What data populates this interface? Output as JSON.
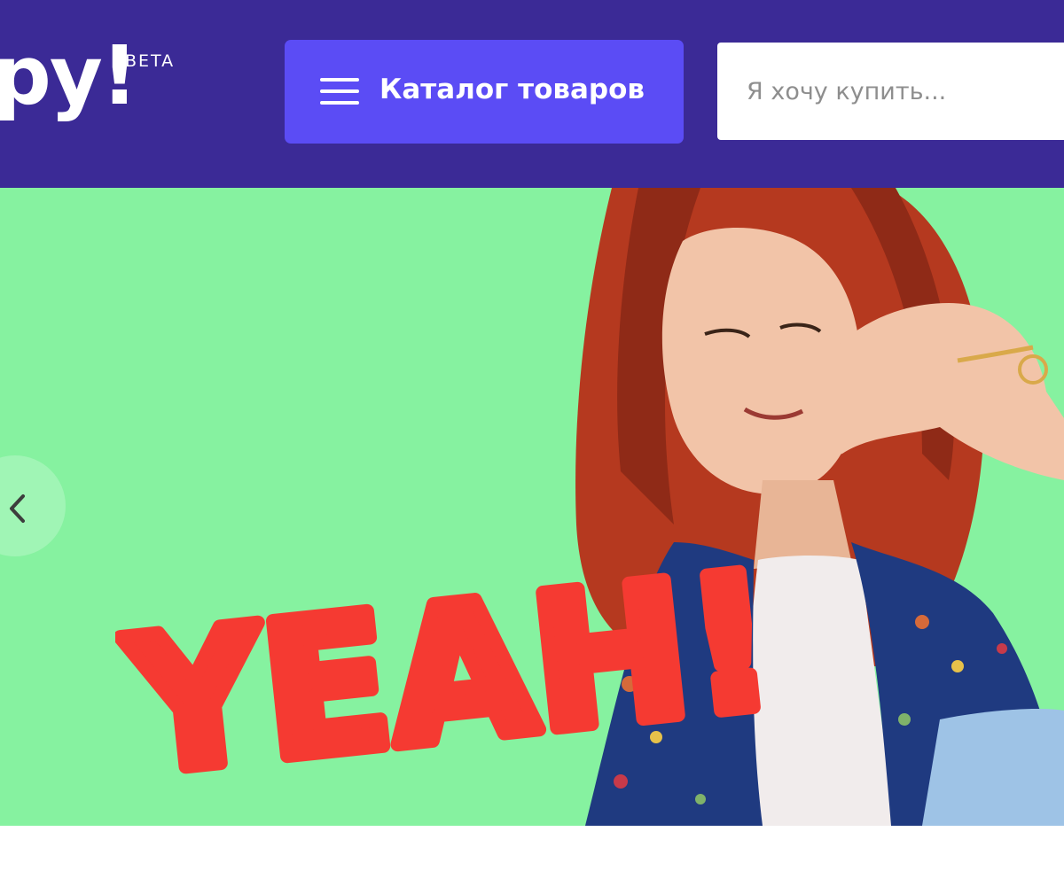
{
  "header": {
    "logo_text": "ру!",
    "logo_badge": "BETA",
    "catalog_button_label": "Каталог товаров",
    "search_placeholder": "Я хочу купить..."
  },
  "hero": {
    "promo_text": "YEAH!",
    "prev_icon": "chevron-left-icon",
    "menu_icon": "hamburger-menu-icon"
  },
  "colors": {
    "header_bg": "#3b2a96",
    "catalog_button_bg": "#5b4cf5",
    "hero_bg": "#86f2a0",
    "promo_text": "#f53a32"
  }
}
